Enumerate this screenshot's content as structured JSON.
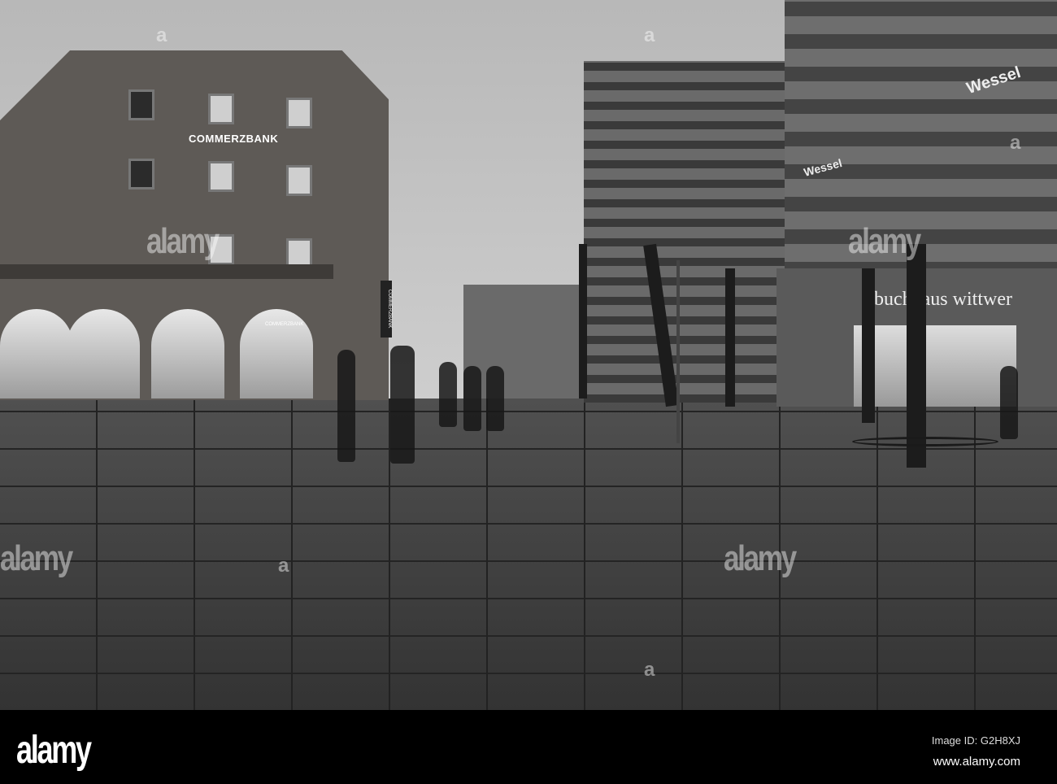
{
  "signs": {
    "bank_facade": "COMMERZBANK",
    "bank_vertical": "COMMERZBANK",
    "bank_entrance": "COMMERZBANK",
    "wessel_upper": "Wessel",
    "wessel_lower": "Wessel",
    "bookstore": "buchhaus wittwer"
  },
  "watermark": {
    "text": "alamy",
    "letter": "a"
  },
  "footer": {
    "logo": "alamy",
    "image_id": "Image ID: G2H8XJ",
    "url": "www.alamy.com"
  }
}
